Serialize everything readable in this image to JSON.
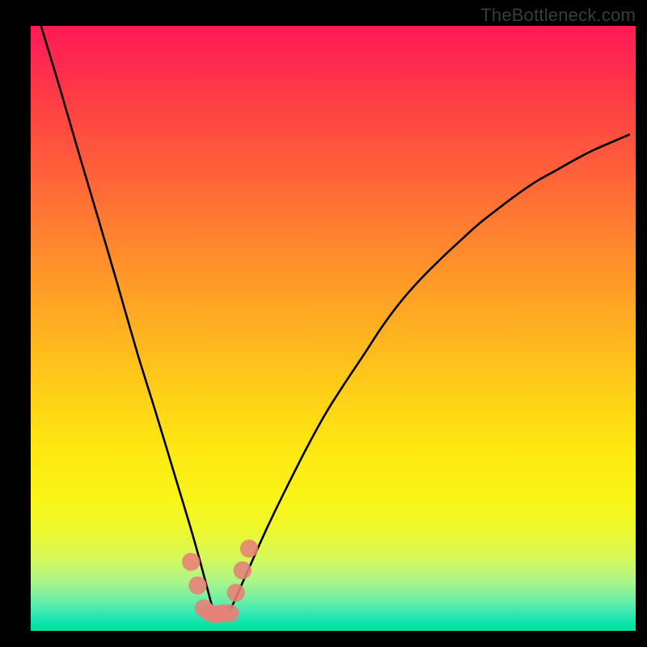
{
  "watermark": "TheBottleneck.com",
  "colors": {
    "background": "#000000",
    "curve": "#000000",
    "dot": "#e78077"
  },
  "chart_data": {
    "type": "line",
    "title": "",
    "xlabel": "",
    "ylabel": "",
    "xlim": [
      0,
      100
    ],
    "ylim": [
      0,
      100
    ],
    "grid": false,
    "notes": "Two black curves on a red-to-green vertical gradient forming a V-shaped dip near x≈30–33; a short cluster of salmon dots sits at the trough. Axes are unlabeled; values are estimated from pixel positions.",
    "series": [
      {
        "name": "left-curve",
        "x": [
          1.7,
          4.9,
          8.0,
          11.2,
          14.4,
          17.6,
          20.7,
          23.9,
          27.1,
          30.2
        ],
        "values": [
          100,
          89.4,
          78.8,
          68.0,
          57.1,
          46.0,
          36.0,
          25.4,
          14.7,
          3.2
        ]
      },
      {
        "name": "right-curve",
        "x": [
          32.9,
          36.1,
          39.2,
          42.4,
          45.6,
          48.8,
          51.9,
          55.1,
          58.3,
          61.4,
          64.6,
          67.8,
          70.9,
          74.1,
          77.3,
          80.5,
          83.6,
          86.8,
          90.0,
          93.1,
          98.9
        ],
        "values": [
          3.2,
          10.4,
          17.3,
          23.9,
          30.2,
          36.0,
          40.9,
          45.7,
          50.6,
          54.7,
          58.3,
          61.5,
          64.4,
          67.3,
          69.8,
          72.2,
          74.3,
          76.1,
          77.9,
          79.5,
          82.0
        ]
      }
    ],
    "markers": [
      {
        "name": "trough-dot-1",
        "x": 26.5,
        "y": 11.4,
        "r": 1.5
      },
      {
        "name": "trough-dot-2",
        "x": 27.6,
        "y": 7.5,
        "r": 1.5
      },
      {
        "name": "trough-dot-3",
        "x": 28.6,
        "y": 3.7,
        "r": 1.5
      },
      {
        "name": "trough-dot-4",
        "x": 29.7,
        "y": 2.9,
        "r": 1.5
      },
      {
        "name": "trough-dot-5",
        "x": 30.7,
        "y": 2.7,
        "r": 1.5
      },
      {
        "name": "trough-dot-6",
        "x": 31.8,
        "y": 2.9,
        "r": 1.5
      },
      {
        "name": "trough-dot-7",
        "x": 32.9,
        "y": 2.9,
        "r": 1.5
      },
      {
        "name": "trough-dot-8",
        "x": 33.9,
        "y": 6.3,
        "r": 1.5
      },
      {
        "name": "trough-dot-9",
        "x": 35.0,
        "y": 10.0,
        "r": 1.5
      },
      {
        "name": "trough-dot-10",
        "x": 36.1,
        "y": 13.6,
        "r": 1.5
      }
    ]
  }
}
